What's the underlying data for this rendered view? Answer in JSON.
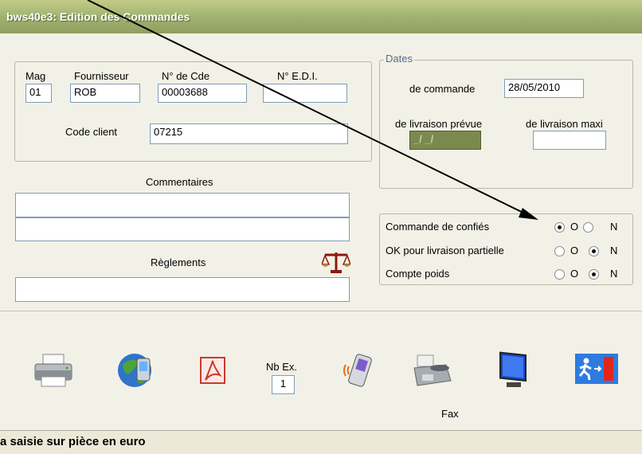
{
  "window": {
    "title": "bws40e3: Edition des Commandes"
  },
  "order": {
    "mag_label": "Mag",
    "mag_value": "01",
    "fournisseur_label": "Fournisseur",
    "fournisseur_value": "ROB",
    "ncde_label": "N° de Cde",
    "ncde_value": "00003688",
    "edi_label": "N° E.D.I.",
    "edi_value": "",
    "client_label": "Code client",
    "client_value": "07215"
  },
  "dates": {
    "legend": "Dates",
    "commande_label": "de commande",
    "commande_value": "28/05/2010",
    "prevue_label": "de livraison prévue",
    "prevue_value": " _/ _/",
    "maxi_label": "de livraison maxi",
    "maxi_value": ""
  },
  "comments": {
    "label": "Commentaires",
    "line1": "",
    "line2": ""
  },
  "reglements": {
    "label": "Règlements",
    "value": ""
  },
  "options": [
    {
      "label": "Commande de confiés",
      "yes": "O",
      "no": "N",
      "selected": "O"
    },
    {
      "label": "OK pour livraison partielle",
      "yes": "O",
      "no": "N",
      "selected": "N"
    },
    {
      "label": "Compte poids",
      "yes": "O",
      "no": "N",
      "selected": "N"
    }
  ],
  "toolbar": {
    "nb_ex_label": "Nb Ex.",
    "nb_ex_value": "1",
    "fax_label": "Fax"
  },
  "status": {
    "text": "a saisie sur pièce en euro"
  },
  "icons": [
    "printer-icon",
    "globe-icon",
    "pdf-icon",
    "mobile-icon",
    "fax-icon",
    "monitor-icon",
    "exit-icon",
    "scales-icon"
  ]
}
